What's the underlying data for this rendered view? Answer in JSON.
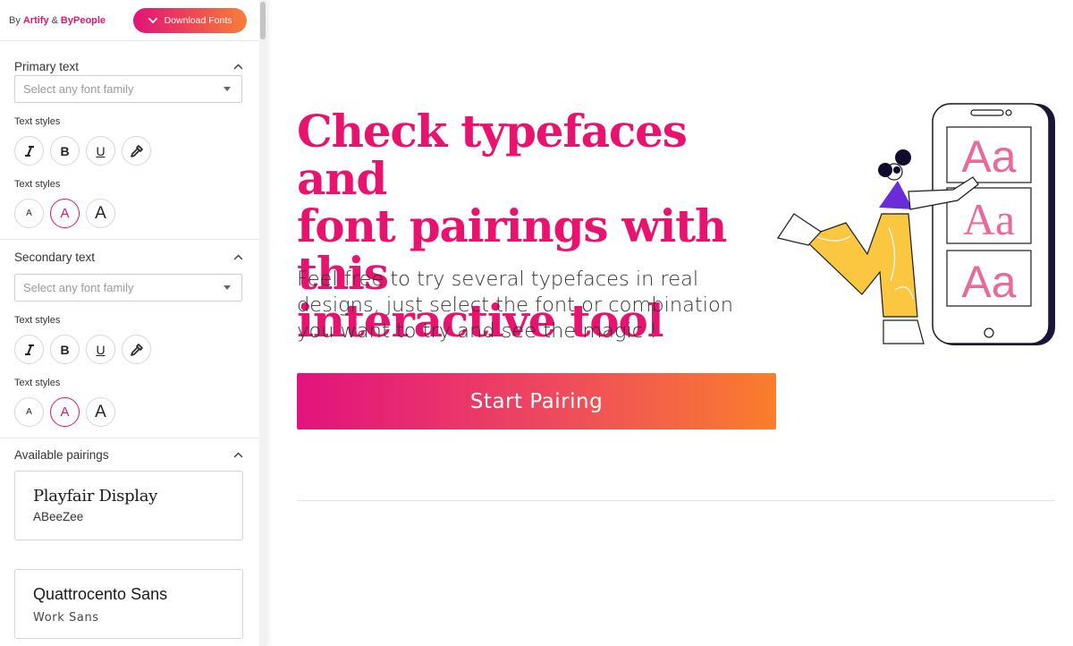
{
  "topbar": {
    "by_label": "By",
    "brand_1": "Artify",
    "amp": "&",
    "brand_2": "ByPeople",
    "download_label": "Download Fonts"
  },
  "primary": {
    "title": "Primary text",
    "select_placeholder": "Select any font family",
    "styles_label_1": "Text styles",
    "styles_label_2": "Text styles",
    "format_buttons": [
      "I",
      "B",
      "U"
    ],
    "size_buttons": [
      "A",
      "A",
      "A"
    ]
  },
  "secondary": {
    "title": "Secondary text",
    "select_placeholder": "Select any font family",
    "styles_label_1": "Text styles",
    "styles_label_2": "Text styles",
    "format_buttons": [
      "I",
      "B",
      "U"
    ],
    "size_buttons": [
      "A",
      "A",
      "A"
    ]
  },
  "pairings": {
    "title": "Available pairings",
    "items": [
      {
        "primary": "Playfair Display",
        "secondary": "ABeeZee"
      },
      {
        "primary": "Quattrocento Sans",
        "secondary": "Work Sans"
      }
    ]
  },
  "hero": {
    "headline_line1": "Check typefaces and",
    "headline_line2": "font pairings with this",
    "headline_line3": "interactive tool",
    "sub_line1": "Feel free to try several typefaces in real",
    "sub_line2": "designs, just select the font or combination",
    "sub_line3": "you want to try and see the magic !",
    "cta_label": "Start Pairing"
  },
  "illustration": {
    "phone_samples": [
      "Aa",
      "Aa",
      "Aa"
    ]
  },
  "colors": {
    "accent": "#e8136e",
    "gradient_start": "#e3127e",
    "gradient_end": "#fa7e2c"
  }
}
